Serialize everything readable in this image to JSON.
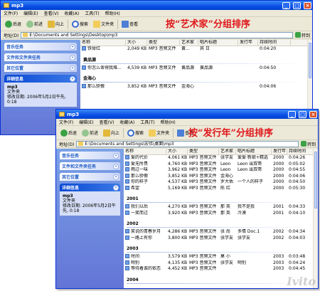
{
  "menu": [
    "文件(F)",
    "编辑(E)",
    "查看(V)",
    "收藏(A)",
    "工具(T)",
    "帮助(H)"
  ],
  "toolbar": {
    "back": "后退",
    "forward": "前进",
    "up": "向上",
    "search": "搜索",
    "folders": "文件夹",
    "view": "查看"
  },
  "window1": {
    "title": "mp3",
    "annotation": "按“艺术家”分组排序",
    "address_label": "地址(D)",
    "address": "E:\\Documents and Settings\\Desktop\\mp3",
    "go": "转到",
    "panes": {
      "music": "音乐任务",
      "file_tasks": "文件和文件夹任务",
      "other": "其它位置",
      "details": "详细信息"
    },
    "details_text": [
      "mp3",
      "文件夹",
      "修改日期: 2006年5月2日午先, 0:18"
    ],
    "columns": [
      "名称",
      "大小",
      "类型",
      "艺术家",
      "唱片标题",
      "发行年",
      "持续时间"
    ],
    "rows": [
      {
        "kind": "row",
        "cells": [
          "铁骨红",
          "2,049 KB",
          "MP3 音频文件",
          "黄...",
          "其 日",
          "",
          "0:04:20"
        ]
      },
      {
        "kind": "group",
        "label": "黄品源"
      },
      {
        "kind": "row",
        "cells": [
          "你怎么舍得我难...",
          "4,539 KB",
          "MP3 音频文件",
          "黄品源",
          "黄品源",
          "",
          "0:04:50"
        ]
      },
      {
        "kind": "group",
        "label": "金海心"
      },
      {
        "kind": "row",
        "cells": [
          "那么骄傲",
          "3,852 KB",
          "MP3 音频文件",
          "金海心",
          "",
          "",
          "0:04:06"
        ]
      }
    ]
  },
  "window2": {
    "title": "mp3",
    "annotation": "按“发行年”分组排序",
    "address_label": "地址(D)",
    "address": "E:\\Documents and Settings\\宏伟\\桌面\\mp3",
    "go": "转到",
    "panes": {
      "music": "音乐任务",
      "file_tasks": "文件和文件夹任务",
      "other": "其它位置",
      "details": "详细信息"
    },
    "details_text": [
      "mp3",
      "文件夹",
      "修改日期: 2006年5月2日午先, 0:18"
    ],
    "columns": [
      "名称",
      "大小",
      "类型",
      "艺术家",
      "唱片标题",
      "发行年",
      "持续时间"
    ],
    "rows": [
      {
        "kind": "row",
        "cells": [
          "爱的代价",
          "4,061 KB",
          "MP3 音频文件",
          "张学友",
          "爱爱·新歌+精选",
          "2000",
          "0:04:26"
        ]
      },
      {
        "kind": "row",
        "cells": [
          "爱无所畏",
          "4,760 KB",
          "MP3 音频文件",
          "Leon",
          "Leon 出双哥",
          "2000",
          "0:05:02"
        ]
      },
      {
        "kind": "row",
        "cells": [
          "雨过一味",
          "3,962 KB",
          "MP3 音频文件",
          "Leon",
          "Leon 出双哥",
          "2000",
          "0:04:55"
        ]
      },
      {
        "kind": "row",
        "cells": [
          "那么骄傲",
          "3,852 KB",
          "MP3 音频文件",
          "金海心",
          "",
          "2000",
          "0:04:06"
        ]
      },
      {
        "kind": "row",
        "cells": [
          "你的样子",
          "4,537 KB",
          "MP3 音频文件",
          "罗大佑",
          "一个人的样子",
          "2000",
          "0:04:50"
        ]
      },
      {
        "kind": "row",
        "cells": [
          "希望",
          "5,169 KB",
          "MP3 音频文件",
          "陈 红",
          "",
          "2000",
          "0:05:30"
        ]
      },
      {
        "kind": "group",
        "label": "2001"
      },
      {
        "kind": "row",
        "cells": [
          "我们以后",
          "4,270 KB",
          "MP3 音频文件",
          "那 英",
          "我不是我",
          "2001",
          "0:04:33"
        ]
      },
      {
        "kind": "row",
        "cells": [
          "一笑而过",
          "3,920 KB",
          "MP3 音频文件",
          "那 英",
          "冷漠",
          "2001",
          "0:04:10"
        ]
      },
      {
        "kind": "group",
        "label": "2002"
      },
      {
        "kind": "row",
        "cells": [
          "笑说的青春岁月",
          "4,286 KB",
          "MP3 音频文件",
          "张 尚",
          "多情 Doc.1",
          "2002",
          "0:04:34"
        ]
      },
      {
        "kind": "row",
        "cells": [
          "一路上有你",
          "3,800 KB",
          "MP3 音频文件",
          "张学友",
          "张学友",
          "2002",
          "0:04:03"
        ]
      },
      {
        "kind": "group",
        "label": "2003"
      },
      {
        "kind": "row",
        "cells": [
          "时间",
          "3,579 KB",
          "MP3 音频文件",
          "莫 小",
          "",
          "2003",
          "0:03:48"
        ]
      },
      {
        "kind": "row",
        "cells": [
          "吻别",
          "4,135 KB",
          "MP3 音频文件",
          "张学友",
          "吻别",
          "2003",
          "0:04:24"
        ]
      },
      {
        "kind": "row",
        "cells": [
          "等待着谁的依恋",
          "4,452 KB",
          "MP3 音频文件",
          "",
          "",
          "2003",
          "0:04:45"
        ]
      },
      {
        "kind": "group",
        "label": "2004"
      }
    ]
  },
  "watermark": "Ivito",
  "colors": {
    "title_bar": "#0a4ee4",
    "task_pane": "#6375d6",
    "annotation": "#e0171b"
  }
}
